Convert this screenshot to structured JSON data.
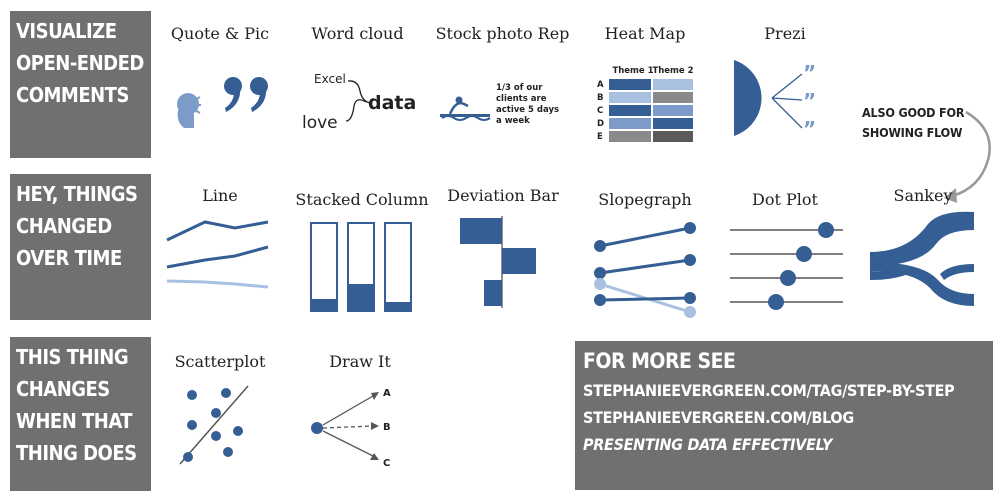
{
  "rows": [
    {
      "lines": [
        "VISUALIZE",
        "OPEN-ENDED",
        "COMMENTS"
      ]
    },
    {
      "lines": [
        "HEY, THINGS",
        "CHANGED",
        "OVER TIME"
      ]
    },
    {
      "lines": [
        "THIS THING",
        "CHANGES",
        "WHEN THAT",
        "THING DOES"
      ]
    }
  ],
  "row1_items": {
    "quote_pic": "Quote & Pic",
    "word_cloud": "Word cloud",
    "stock_photo": "Stock photo Rep",
    "heat_map": "Heat Map",
    "prezi": "Prezi"
  },
  "row2_items": {
    "line": "Line",
    "stacked_column": "Stacked Column",
    "deviation_bar": "Deviation Bar",
    "slopegraph": "Slopegraph",
    "dot_plot": "Dot Plot",
    "sankey": "Sankey"
  },
  "row3_items": {
    "scatterplot": "Scatterplot",
    "draw_it": "Draw It"
  },
  "word_cloud_words": {
    "excel": "Excel",
    "love": "love",
    "data": "data"
  },
  "stock_photo_text": [
    "1/3 of our",
    "clients are",
    "active 5 days",
    "a week"
  ],
  "heat_map_headers": [
    "Theme 1",
    "Theme 2"
  ],
  "heat_map_rows": [
    "A",
    "B",
    "C",
    "D",
    "E"
  ],
  "draw_it_labels": [
    "A",
    "B",
    "C"
  ],
  "note": [
    "ALSO GOOD FOR",
    "SHOWING FLOW"
  ],
  "more": {
    "title": "FOR MORE SEE",
    "link1": "STEPHANIEEVERGREEN.COM/TAG/STEP-BY-STEP",
    "link2": "STEPHANIEEVERGREEN.COM/BLOG",
    "book": "PRESENTING DATA EFFECTIVELY"
  },
  "colors": {
    "label_gray": "#707070",
    "dark_blue": "#355e94",
    "mid_blue": "#7d9bc8",
    "light_blue": "#a9c1e0",
    "dark_gray": "#5a5a5a",
    "light_gray": "#b5b5b5"
  }
}
